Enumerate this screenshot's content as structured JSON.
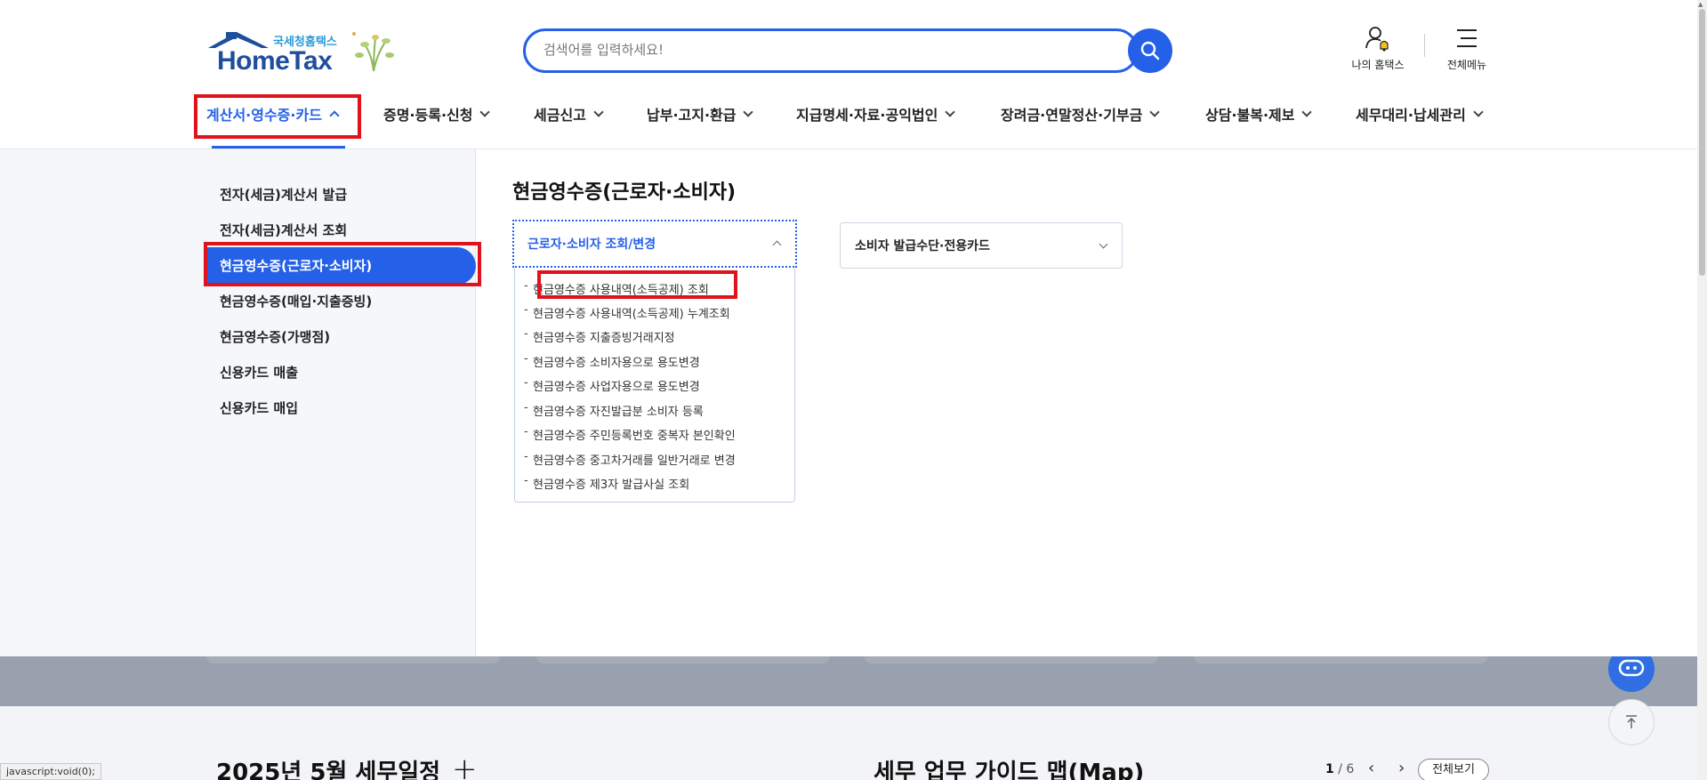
{
  "header": {
    "logo_sub": "국세청홈택스",
    "logo_main": "HomeTax",
    "search_placeholder": "검색어를 입력하세요!",
    "my_hometax": "나의 홈택스",
    "all_menu": "전체메뉴"
  },
  "gnb": [
    {
      "label": "계산서·영수증·카드"
    },
    {
      "label": "증명·등록·신청"
    },
    {
      "label": "세금신고"
    },
    {
      "label": "납부·고지·환급"
    },
    {
      "label": "지급명세·자료·공익법인"
    },
    {
      "label": "장려금·연말정산·기부금"
    },
    {
      "label": "상담·불복·제보"
    },
    {
      "label": "세무대리·납세관리"
    }
  ],
  "lnb": [
    {
      "label": "전자(세금)계산서 발급"
    },
    {
      "label": "전자(세금)계산서 조회"
    },
    {
      "label": "현금영수증(근로자·소비자)"
    },
    {
      "label": "현금영수증(매입·지출증빙)"
    },
    {
      "label": "현금영수증(가맹점)"
    },
    {
      "label": "신용카드 매출"
    },
    {
      "label": "신용카드 매입"
    }
  ],
  "content": {
    "section_title": "현금영수증(근로자·소비자)",
    "accordion1": {
      "title": "근로자·소비자 조회/변경",
      "links": [
        "현금영수증 사용내역(소득공제) 조회",
        "현금영수증 사용내역(소득공제) 누계조회",
        "현금영수증 지출증빙거래지정",
        "현금영수증 소비자용으로 용도변경",
        "현금영수증 사업자용으로 용도변경",
        "현금영수증 자진발급분 소비자 등록",
        "현금영수증 주민등록번호 중복자 본인확인",
        "현금영수증 중고차거래를 일반거래로 변경",
        "현금영수증 제3자 발급사실 조회"
      ]
    },
    "accordion2": {
      "title": "소비자 발급수단·전용카드"
    }
  },
  "background": {
    "schedule_title": "2025년 5월 세무일정",
    "guide_title": "세무 업무 가이드 맵(Map)",
    "pager_current": "1",
    "pager_total": "/ 6",
    "view_all": "전체보기"
  },
  "status_bar": "javascript:void(0);",
  "colors": {
    "accent": "#2561e8",
    "highlight": "#e0121b",
    "logo_blue": "#1f4e9c"
  }
}
